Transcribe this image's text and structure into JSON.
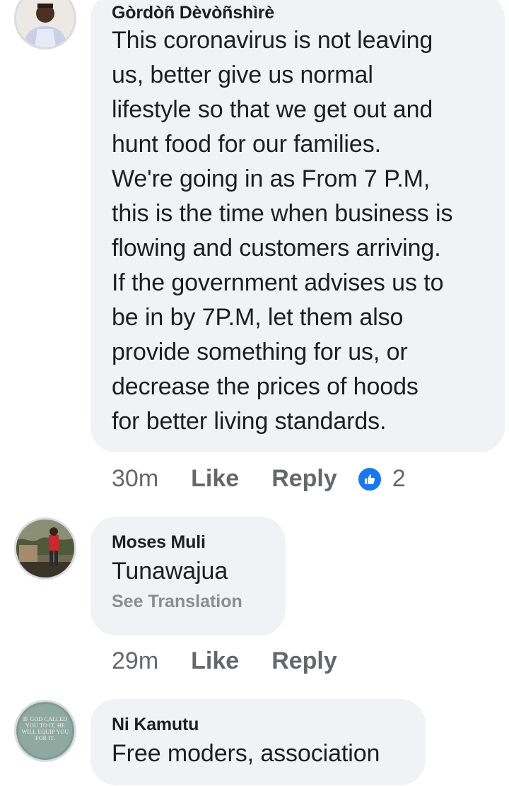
{
  "comments": [
    {
      "author": "Gòrdòñ Dèvòñshìrè",
      "text_lines": [
        "This coronavirus is not leaving",
        "us, better give us normal",
        "lifestyle so that we get out and",
        "hunt food for our families.",
        "We're going in as From 7 P.M,",
        "this is the time when business is",
        "flowing and customers arriving.",
        "If the government advises us to",
        "be in by 7P.M, let them also",
        "provide something for us, or",
        "decrease the prices of hoods",
        "for better living standards."
      ],
      "time": "30m",
      "like_label": "Like",
      "reply_label": "Reply",
      "reaction_icon": "like-icon",
      "reaction_count": "2"
    },
    {
      "author": "Moses Muli",
      "text": "Tunawajua",
      "see_translation": "See Translation",
      "time": "29m",
      "like_label": "Like",
      "reply_label": "Reply"
    },
    {
      "author": "Ni Kamutu",
      "text": "Free moders, association",
      "avatar_text": "IF GOD CALLED YOU TO IT, HE WILL EQUIP YOU FOR IT."
    }
  ],
  "colors": {
    "bubble": "#f0f2f5",
    "meta": "#65676b",
    "reaction_blue": "#1877f2"
  }
}
